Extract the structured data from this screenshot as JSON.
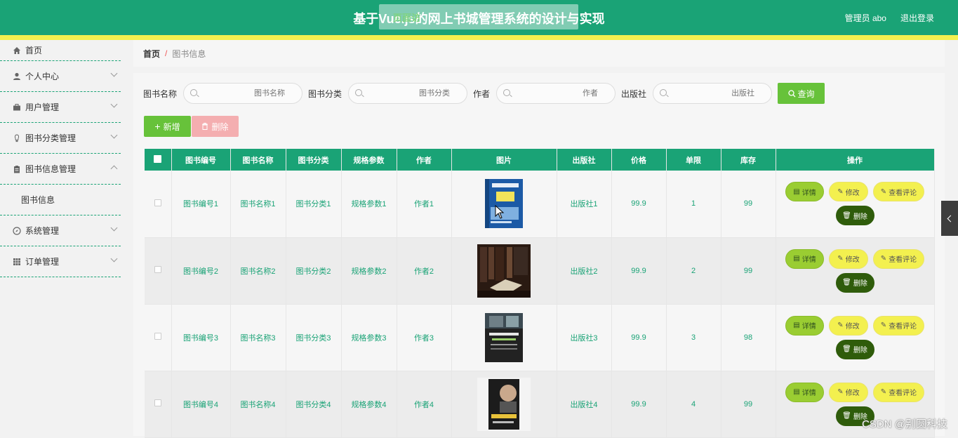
{
  "header": {
    "title": "基于Vue.js的网上书城管理系统的设计与实现",
    "overlay_text": "页面访",
    "user_label": "管理员 abo",
    "logout_label": "退出登录"
  },
  "sidebar": {
    "items": [
      {
        "label": "首页"
      },
      {
        "label": "个人中心"
      },
      {
        "label": "用户管理"
      },
      {
        "label": "图书分类管理"
      },
      {
        "label": "图书信息管理"
      },
      {
        "label": "系统管理"
      },
      {
        "label": "订单管理"
      }
    ],
    "subitem": "图书信息"
  },
  "breadcrumb": {
    "home": "首页",
    "separator": "/",
    "current": "图书信息"
  },
  "search": {
    "book_name_label": "图书名称",
    "book_name_placeholder": "图书名称",
    "category_label": "图书分类",
    "category_placeholder": "图书分类",
    "author_label": "作者",
    "author_placeholder": "作者",
    "publisher_label": "出版社",
    "publisher_placeholder": "出版社",
    "query_button": "查询"
  },
  "actions": {
    "add_button": "新增",
    "delete_button": "删除"
  },
  "table": {
    "headers": [
      "图书编号",
      "图书名称",
      "图书分类",
      "规格参数",
      "作者",
      "图片",
      "出版社",
      "价格",
      "单限",
      "库存",
      "操作"
    ],
    "rows": [
      {
        "id": "图书编号1",
        "name": "图书名称1",
        "category": "图书分类1",
        "spec": "规格参数1",
        "author": "作者1",
        "cover": "blue-book-cover",
        "publisher": "出版社1",
        "price": "99.9",
        "limit": "1",
        "stock": "99"
      },
      {
        "id": "图书编号2",
        "name": "图书名称2",
        "category": "图书分类2",
        "spec": "规格参数2",
        "author": "作者2",
        "cover": "library-photo",
        "publisher": "出版社2",
        "price": "99.9",
        "limit": "2",
        "stock": "99"
      },
      {
        "id": "图书编号3",
        "name": "图书名称3",
        "category": "图书分类3",
        "spec": "规格参数3",
        "author": "作者3",
        "cover": "dark-book-cover",
        "publisher": "出版社3",
        "price": "99.9",
        "limit": "3",
        "stock": "98"
      },
      {
        "id": "图书编号4",
        "name": "图书名称4",
        "category": "图书分类4",
        "spec": "规格参数4",
        "author": "作者4",
        "cover": "portrait-book-cover",
        "publisher": "出版社4",
        "price": "99.9",
        "limit": "4",
        "stock": "99"
      }
    ],
    "op_labels": {
      "detail": "详情",
      "edit": "修改",
      "comment": "查看评论",
      "delete": "删除"
    }
  },
  "watermark": "CSDN @别圆科技",
  "colors": {
    "primary": "#1aa376",
    "accent_yellow": "#f3f04f",
    "success": "#67c23a",
    "danger_light": "#f4aeb0",
    "delete_dark": "#2f5c0b"
  }
}
